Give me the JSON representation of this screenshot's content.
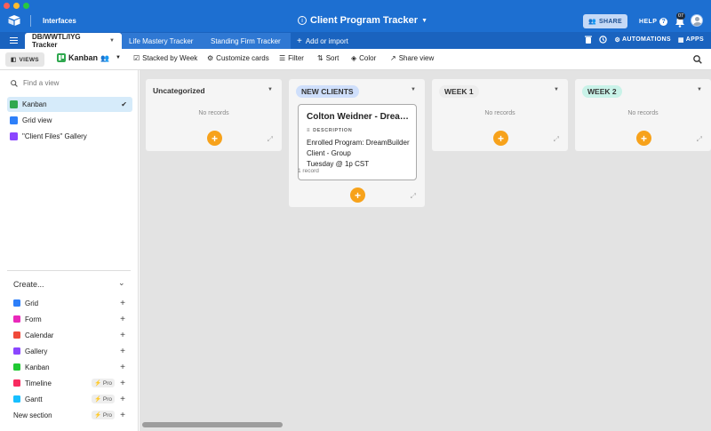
{
  "topbar": {
    "interfaces_label": "Interfaces",
    "base_title": "Client Program Tracker",
    "share_label": "SHARE",
    "help_label": "HELP",
    "notification_count": "07"
  },
  "tabs": {
    "items": [
      {
        "label": "DB/WWTL/IYG Tracker"
      },
      {
        "label": "Life Mastery Tracker"
      },
      {
        "label": "Standing Firm Tracker"
      }
    ],
    "add_label": "Add or import",
    "automations_label": "AUTOMATIONS",
    "apps_label": "APPS"
  },
  "viewbar": {
    "views_label": "VIEWS",
    "current_view": "Kanban",
    "stacked_by": "Stacked by Week",
    "customize": "Customize cards",
    "filter": "Filter",
    "sort": "Sort",
    "color": "Color",
    "share_view": "Share view"
  },
  "sidebar": {
    "find_placeholder": "Find a view",
    "views": [
      {
        "label": "Kanban",
        "color": "#2fa84f"
      },
      {
        "label": "Grid view",
        "color": "#2d7ff9"
      },
      {
        "label": "\"Client Files\" Gallery",
        "color": "#8b46ff"
      }
    ],
    "create_label": "Create...",
    "create_items": [
      {
        "label": "Grid",
        "color": "#2d7ff9"
      },
      {
        "label": "Form",
        "color": "#e929ba"
      },
      {
        "label": "Calendar",
        "color": "#f82b60"
      },
      {
        "label": "Gallery",
        "color": "#8b46ff"
      },
      {
        "label": "Kanban",
        "color": "#20c933"
      },
      {
        "label": "Timeline",
        "color": "#f82b60",
        "pro": "Pro"
      },
      {
        "label": "Gantt",
        "color": "#18bfff",
        "pro": "Pro"
      },
      {
        "label": "New section",
        "color": "",
        "pro": "Pro"
      }
    ]
  },
  "board": {
    "stacks": [
      {
        "title": "Uncategorized",
        "empty_text": "No records"
      },
      {
        "title": "NEW CLIENTS",
        "pill_color": "#cfdffb",
        "record_count": "1 record",
        "card": {
          "title": "Colton Weidner - DreamBuilder",
          "field_label": "DESCRIPTION",
          "lines": [
            "Enrolled Program: DreamBuilder",
            "Client - Group",
            "Tuesday @ 1p CST"
          ]
        }
      },
      {
        "title": "WEEK 1",
        "pill_color": "#ededed",
        "empty_text": "No records"
      },
      {
        "title": "WEEK 2",
        "pill_color": "#c9f2e8",
        "empty_text": "No records"
      }
    ]
  },
  "colors": {
    "accent": "#1d6fd1",
    "add_button": "#f7a21b",
    "board_bg": "#e3e3e3"
  }
}
